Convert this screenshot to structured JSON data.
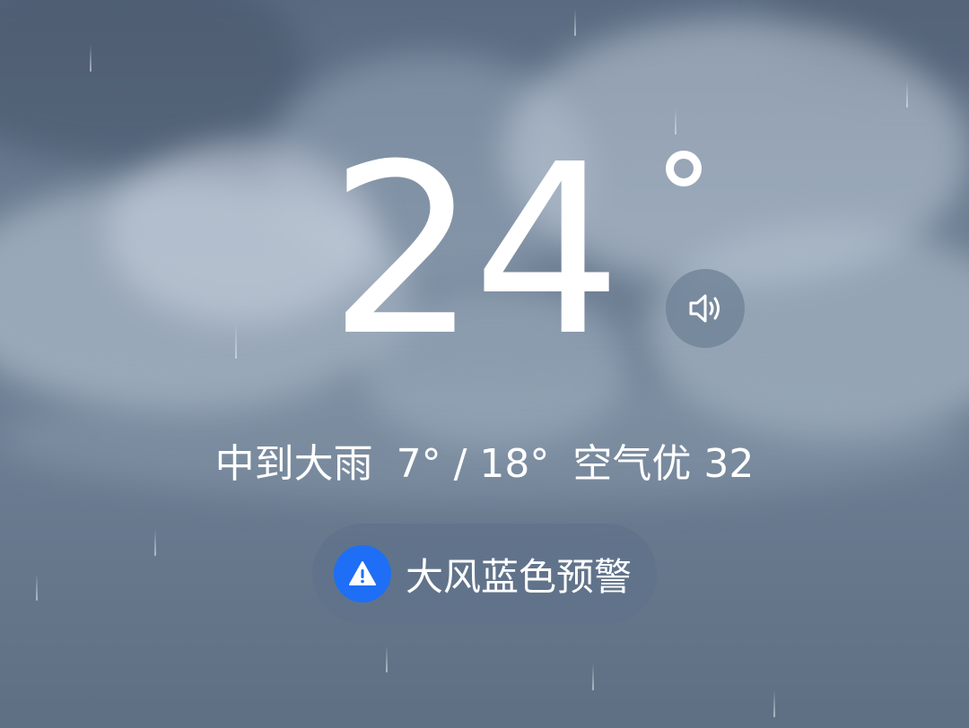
{
  "current": {
    "temperature": "24",
    "condition": "中到大雨",
    "temp_range": "7° / 18°",
    "air_quality": "空气优 32"
  },
  "alert": {
    "label": "大风蓝色预警",
    "icon": "warning-icon",
    "icon_color": "#1e6ff5"
  },
  "controls": {
    "speaker_icon": "speaker-icon"
  }
}
